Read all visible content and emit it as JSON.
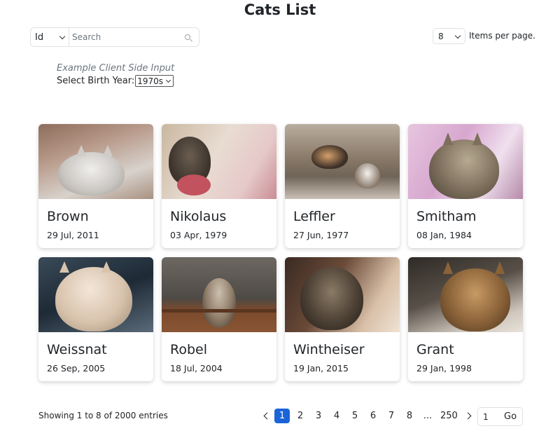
{
  "page": {
    "title": "Cats List"
  },
  "search": {
    "field_value": "Id",
    "placeholder": "Search"
  },
  "per_page": {
    "value": "8",
    "label": "Items per page."
  },
  "client_input": {
    "caption": "Example Client Side Input",
    "label": "Select Birth Year:",
    "value": "1970s"
  },
  "cards": [
    {
      "name": "Brown",
      "date": "29 Jul, 2011"
    },
    {
      "name": "Nikolaus",
      "date": "03 Apr, 1979"
    },
    {
      "name": "Leffler",
      "date": "27 Jun, 1977"
    },
    {
      "name": "Smitham",
      "date": "08 Jan, 1984"
    },
    {
      "name": "Weissnat",
      "date": "26 Sep, 2005"
    },
    {
      "name": "Robel",
      "date": "18 Jul, 2004"
    },
    {
      "name": "Wintheiser",
      "date": "19 Jan, 2015"
    },
    {
      "name": "Grant",
      "date": "29 Jan, 1998"
    }
  ],
  "footer": {
    "entries_text": "Showing 1 to 8 of 2000 entries",
    "pages": [
      "1",
      "2",
      "3",
      "4",
      "5",
      "6",
      "7",
      "8",
      "...",
      "250"
    ],
    "active_page": "1",
    "goto_value": "1",
    "goto_label": "Go"
  },
  "colors": {
    "accent": "#1a64d8",
    "muted": "#6c757d",
    "border": "#dee2e6"
  },
  "icons": {
    "search": "search-icon",
    "prev": "chevron-left-icon",
    "next": "chevron-right-icon",
    "dropdown": "chevron-down-icon"
  }
}
